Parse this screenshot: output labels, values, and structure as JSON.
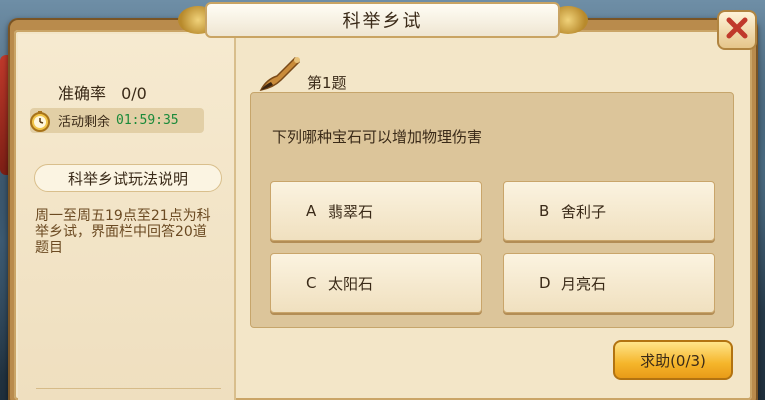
{
  "window": {
    "title": "科举乡试"
  },
  "stats": {
    "accuracy_label": "准确率",
    "accuracy_value": "0/0",
    "timer_label": "活动剩余",
    "timer_value": "01:59:35"
  },
  "rules": {
    "title": "科举乡试玩法说明",
    "text": "周一至周五19点至21点为科举乡试，界面栏中回答20道题目"
  },
  "question": {
    "number": "第1题",
    "text": "下列哪种宝石可以增加物理伤害",
    "options": [
      {
        "letter": "A",
        "text": "翡翠石"
      },
      {
        "letter": "B",
        "text": "舍利子"
      },
      {
        "letter": "C",
        "text": "太阳石"
      },
      {
        "letter": "D",
        "text": "月亮石"
      }
    ]
  },
  "help_button": "求助(0/3)",
  "icons": {
    "close": "close-icon",
    "clock": "clock-icon",
    "brush": "brush-icon"
  },
  "colors": {
    "timer_green": "#1b8a3a",
    "close_red": "#c0392b",
    "help_gold": "#f5b52a"
  }
}
